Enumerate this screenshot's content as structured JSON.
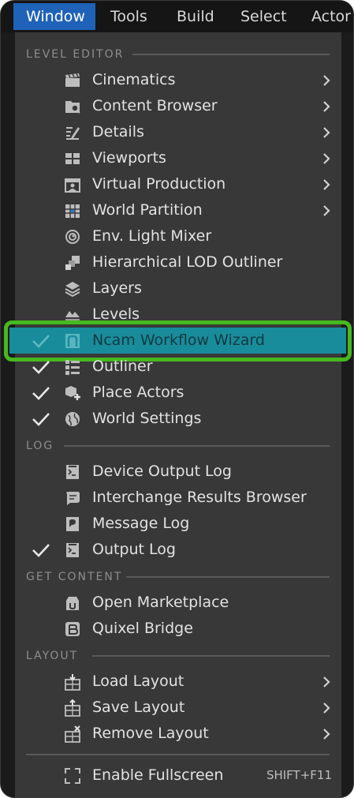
{
  "menubar": {
    "items": [
      {
        "label": "Window",
        "active": true
      },
      {
        "label": "Tools"
      },
      {
        "label": "Build"
      },
      {
        "label": "Select"
      },
      {
        "label": "Actor"
      }
    ]
  },
  "sections": {
    "level_editor": "LEVEL EDITOR",
    "log": "LOG",
    "get_content": "GET CONTENT",
    "layout": "LAYOUT"
  },
  "level_editor_items": [
    {
      "label": "Cinematics",
      "icon": "clapperboard-icon",
      "submenu": true,
      "checked": false
    },
    {
      "label": "Content Browser",
      "icon": "content-browser-icon",
      "submenu": true,
      "checked": false
    },
    {
      "label": "Details",
      "icon": "details-pencil-icon",
      "submenu": true,
      "checked": false
    },
    {
      "label": "Viewports",
      "icon": "viewports-grid-icon",
      "submenu": true,
      "checked": false
    },
    {
      "label": "Virtual Production",
      "icon": "virtual-production-icon",
      "submenu": true,
      "checked": false
    },
    {
      "label": "World Partition",
      "icon": "world-partition-icon",
      "submenu": true,
      "checked": false
    },
    {
      "label": "Env. Light Mixer",
      "icon": "light-mixer-icon",
      "submenu": false,
      "checked": false
    },
    {
      "label": "Hierarchical LOD Outliner",
      "icon": "hlod-outliner-icon",
      "submenu": false,
      "checked": false
    },
    {
      "label": "Layers",
      "icon": "layers-icon",
      "submenu": false,
      "checked": false
    },
    {
      "label": "Levels",
      "icon": "levels-icon",
      "submenu": false,
      "checked": false
    },
    {
      "label": "Ncam Workflow Wizard",
      "icon": "ncam-icon",
      "submenu": false,
      "checked": true,
      "highlighted": true
    },
    {
      "label": "Outliner",
      "icon": "outliner-icon",
      "submenu": false,
      "checked": true
    },
    {
      "label": "Place Actors",
      "icon": "place-actors-icon",
      "submenu": false,
      "checked": true
    },
    {
      "label": "World Settings",
      "icon": "world-settings-icon",
      "submenu": false,
      "checked": true
    }
  ],
  "log_items": [
    {
      "label": "Device Output Log",
      "icon": "device-log-icon",
      "checked": false
    },
    {
      "label": "Interchange Results Browser",
      "icon": "interchange-icon",
      "checked": false
    },
    {
      "label": "Message Log",
      "icon": "message-log-icon",
      "checked": false
    },
    {
      "label": "Output Log",
      "icon": "output-log-icon",
      "checked": true
    }
  ],
  "get_content_items": [
    {
      "label": "Open Marketplace",
      "icon": "marketplace-icon"
    },
    {
      "label": "Quixel Bridge",
      "icon": "quixel-bridge-icon"
    }
  ],
  "layout_items": [
    {
      "label": "Load Layout",
      "icon": "load-layout-icon",
      "submenu": true
    },
    {
      "label": "Save Layout",
      "icon": "save-layout-icon",
      "submenu": true
    },
    {
      "label": "Remove Layout",
      "icon": "remove-layout-icon",
      "submenu": true
    }
  ],
  "fullscreen": {
    "label": "Enable Fullscreen",
    "icon": "fullscreen-icon",
    "shortcut": "SHIFT+F11"
  },
  "colors": {
    "accent": "#1f62b8",
    "highlight": "#198c9c",
    "highlight_border": "#46b91f",
    "menu_bg": "#383838"
  }
}
